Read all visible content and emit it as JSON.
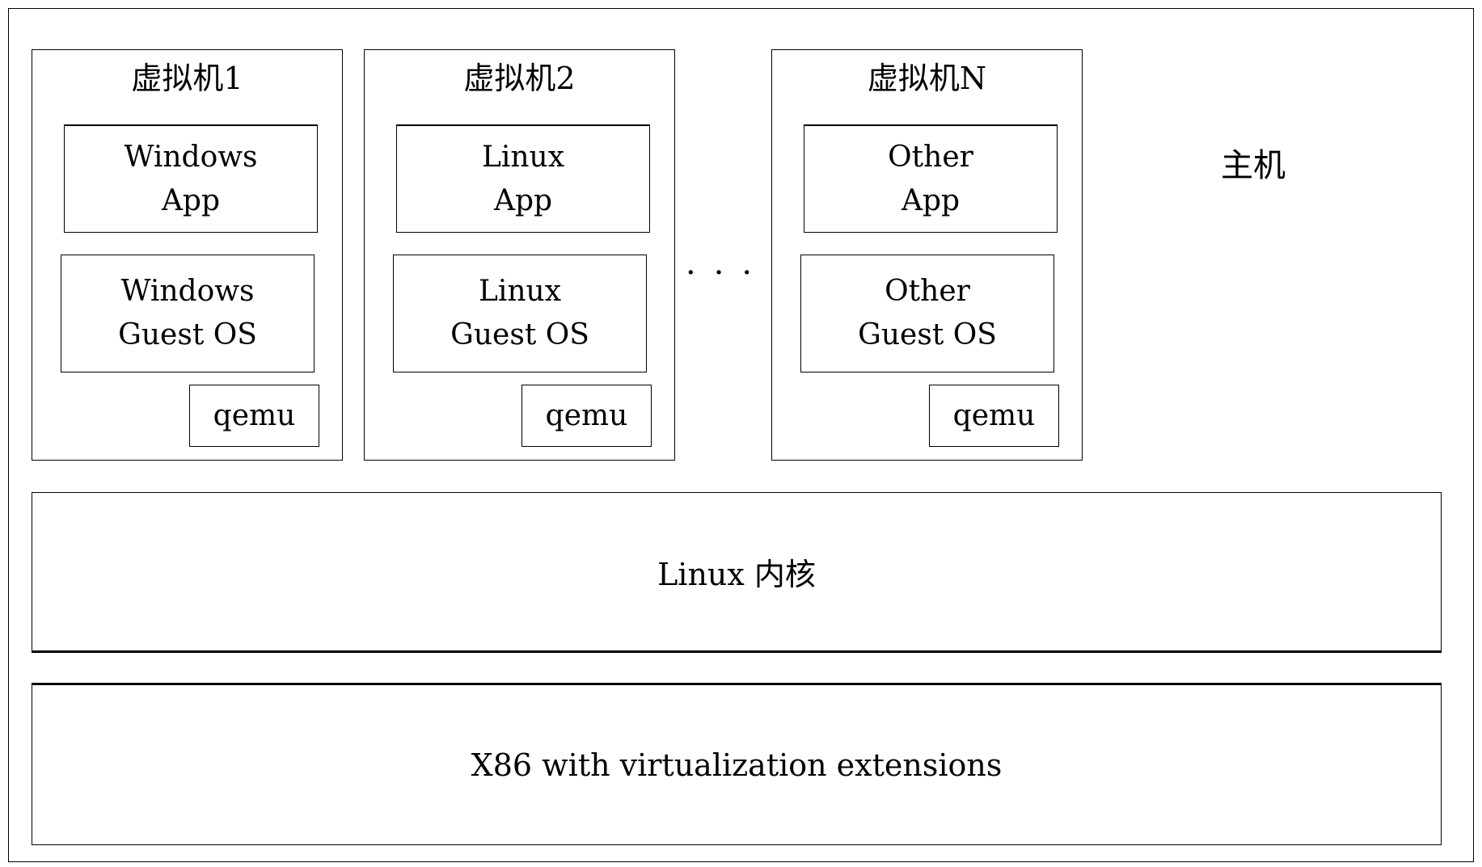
{
  "host_label": "主机",
  "ellipsis": "···",
  "vms": [
    {
      "title": "虚拟机1",
      "app": "Windows\nApp",
      "os": "Windows\nGuest OS",
      "emulator": "qemu"
    },
    {
      "title": "虚拟机2",
      "app": "Linux\nApp",
      "os": "Linux\nGuest OS",
      "emulator": "qemu"
    },
    {
      "title": "虚拟机N",
      "app": "Other\nApp",
      "os": "Other\nGuest OS",
      "emulator": "qemu"
    }
  ],
  "kernel_label": "Linux 内核",
  "hardware_label": "X86 with virtualization extensions"
}
